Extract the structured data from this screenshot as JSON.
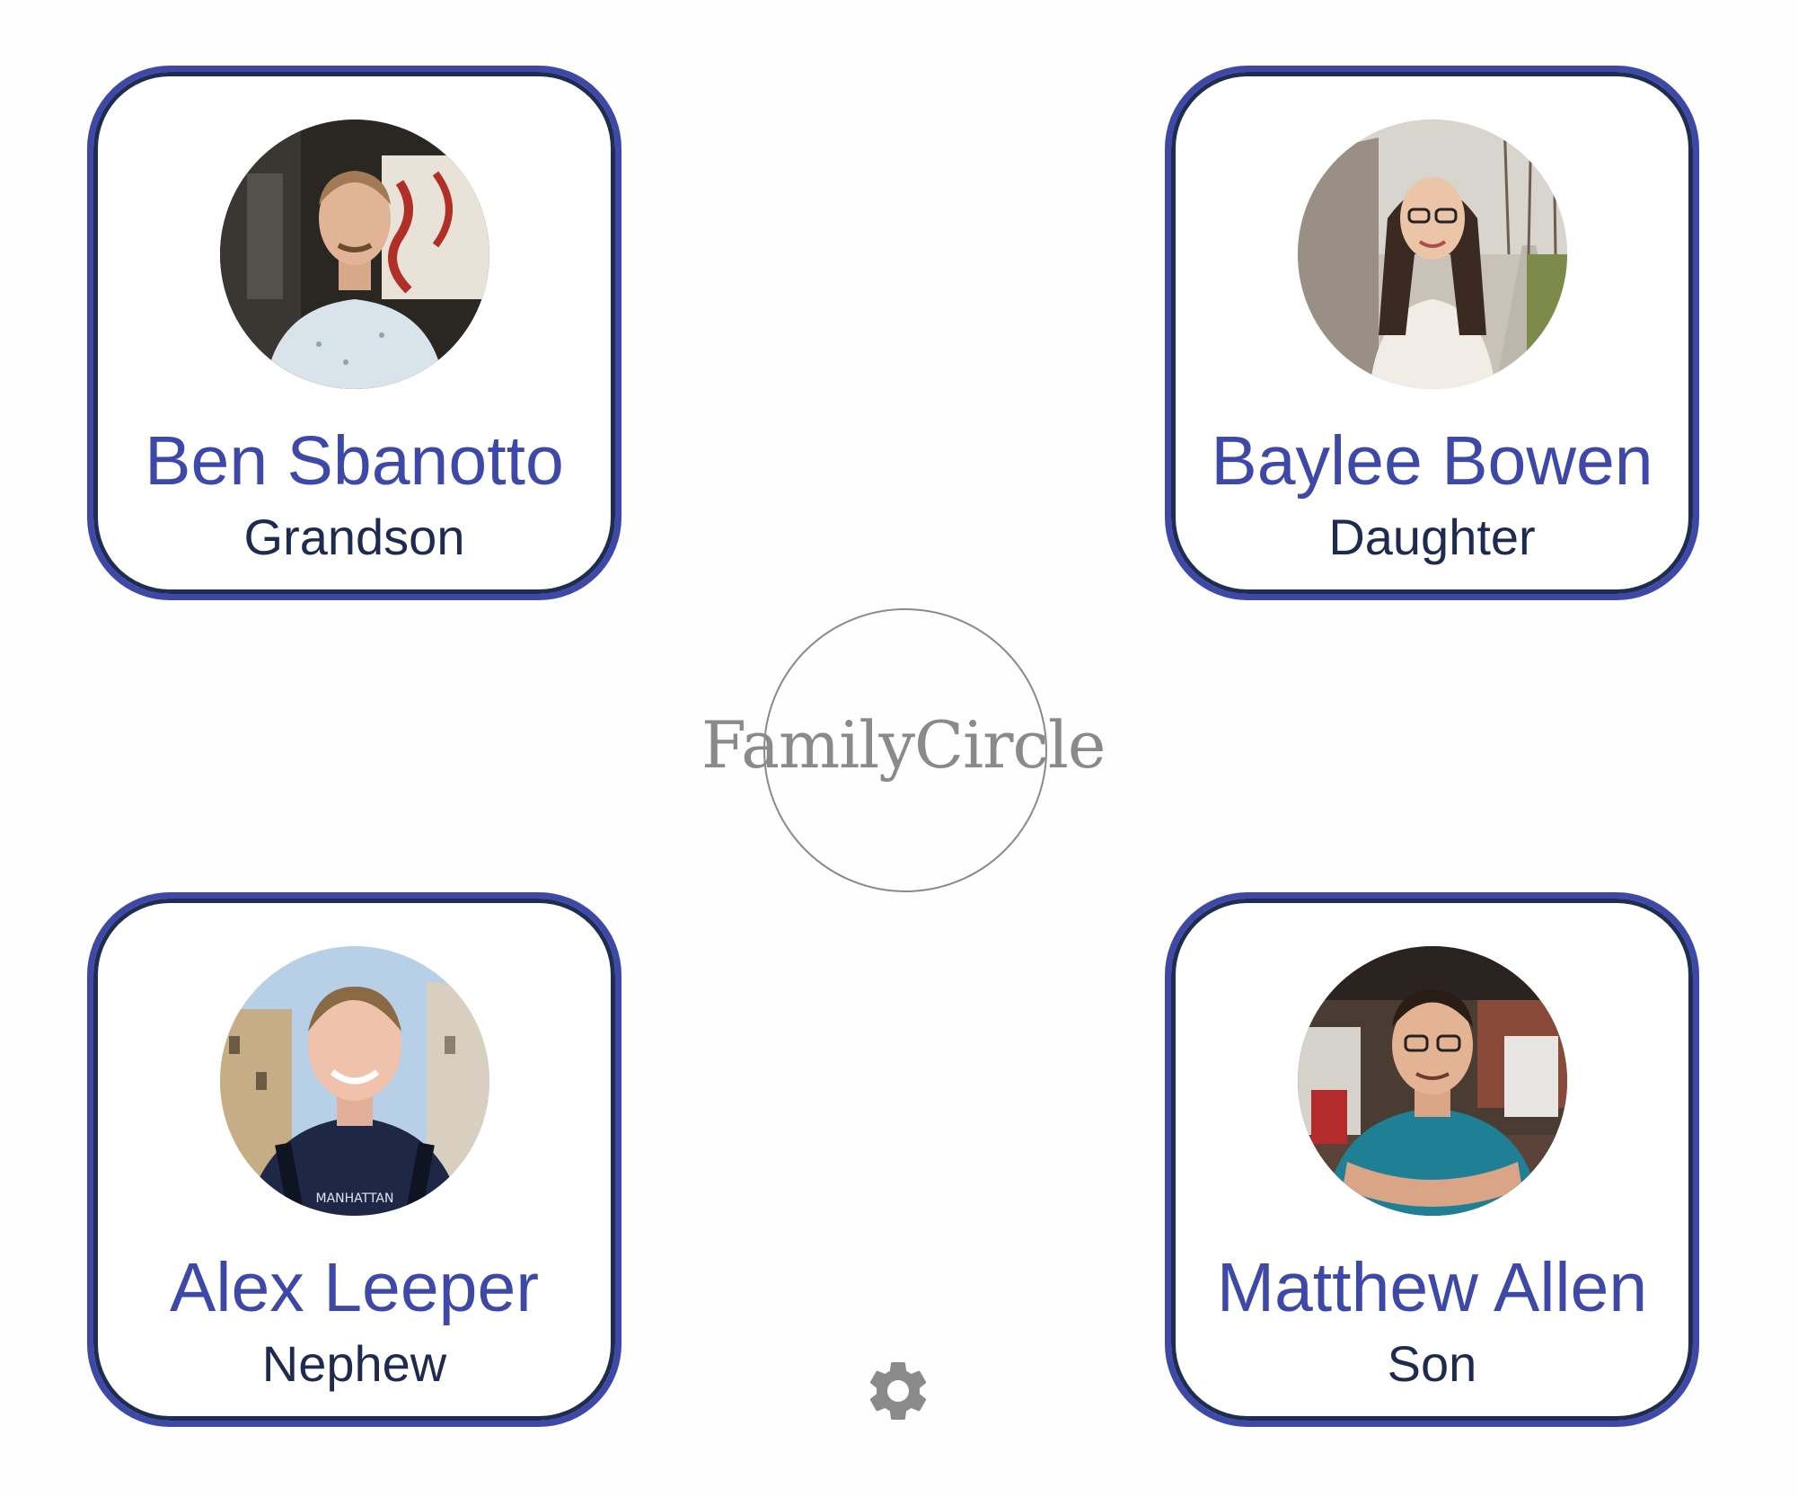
{
  "app": {
    "logo_text": "FamilyCircle"
  },
  "colors": {
    "card_border": "#3d48a8",
    "card_border_inner": "#1f2d52",
    "name": "#3d48a8",
    "relation": "#1e2a4f",
    "logo": "#8a8a8a",
    "settings_icon": "#8a8a8a"
  },
  "contacts": [
    {
      "name": "Ben Sbanotto",
      "relation": "Grandson",
      "avatar": "photo-of-man-in-light-patterned-shirt"
    },
    {
      "name": "Baylee Bowen",
      "relation": "Daughter",
      "avatar": "photo-of-woman-with-glasses-outdoors"
    },
    {
      "name": "Alex Leeper",
      "relation": "Nephew",
      "avatar": "photo-of-young-man-in-navy-tshirt"
    },
    {
      "name": "Matthew Allen",
      "relation": "Son",
      "avatar": "photo-of-man-in-teal-polo-arms-crossed"
    }
  ],
  "settings": {
    "icon": "gear-icon"
  }
}
